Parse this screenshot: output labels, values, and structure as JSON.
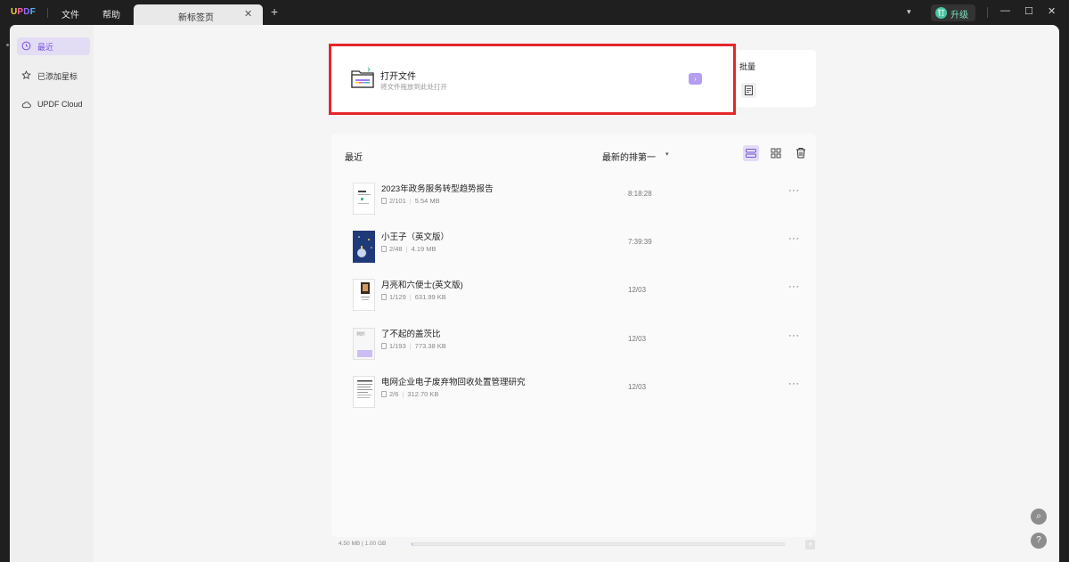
{
  "app": {
    "logo": {
      "u": "U",
      "p": "P",
      "d": "D",
      "f": "F"
    }
  },
  "menu": {
    "file": "文件",
    "help": "帮助"
  },
  "tab": {
    "title": "新标签页",
    "close": "✕",
    "add": "+"
  },
  "titlebar_right": {
    "upgrade_badge": "钉",
    "upgrade_label": "升级",
    "chevron": "▾",
    "minimize": "—",
    "maximize": "☐",
    "close": "✕"
  },
  "sidebar": {
    "items": [
      {
        "label": "最近",
        "icon": "clock-icon",
        "active": true
      },
      {
        "label": "已添加星标",
        "icon": "star-icon",
        "active": false
      },
      {
        "label": "UPDF Cloud",
        "icon": "cloud-icon",
        "active": false
      }
    ]
  },
  "open_file": {
    "title": "打开文件",
    "subtitle": "将文件拖放到此处打开",
    "arrow": "›",
    "icon": "folder-icon"
  },
  "batch": {
    "title": "批量",
    "icon": "batch-icon"
  },
  "recent": {
    "title": "最近",
    "sort_label": "最新的排第一",
    "sort_caret": "▾",
    "files": [
      {
        "name": "2023年政务服务转型趋势报告",
        "pages": "2/101",
        "size": "5.54 MB",
        "time": "8:18:28",
        "more": "···"
      },
      {
        "name": "小王子（英文版）",
        "pages": "2/48",
        "size": "4.19 MB",
        "time": "7:39:39",
        "more": "···"
      },
      {
        "name": "月亮和六便士(英文版)",
        "pages": "1/129",
        "size": "631.99 KB",
        "time": "12/03",
        "more": "···"
      },
      {
        "name": "了不起的盖茨比",
        "pages": "1/193",
        "size": "773.38 KB",
        "time": "12/03",
        "more": "···"
      },
      {
        "name": "电网企业电子废弃物回收处置管理研究",
        "pages": "2/6",
        "size": "312.70 KB",
        "time": "12/03",
        "more": "···"
      }
    ]
  },
  "storage": {
    "label": "4.50 MB | 1.00 GB",
    "used_fraction": 0.0044,
    "plus": "+"
  },
  "floating": {
    "search": "⌕",
    "help": "?"
  },
  "colors": {
    "accent": "#7a55d9",
    "highlight": "#e5262a",
    "upgrade": "#48c6a3"
  }
}
